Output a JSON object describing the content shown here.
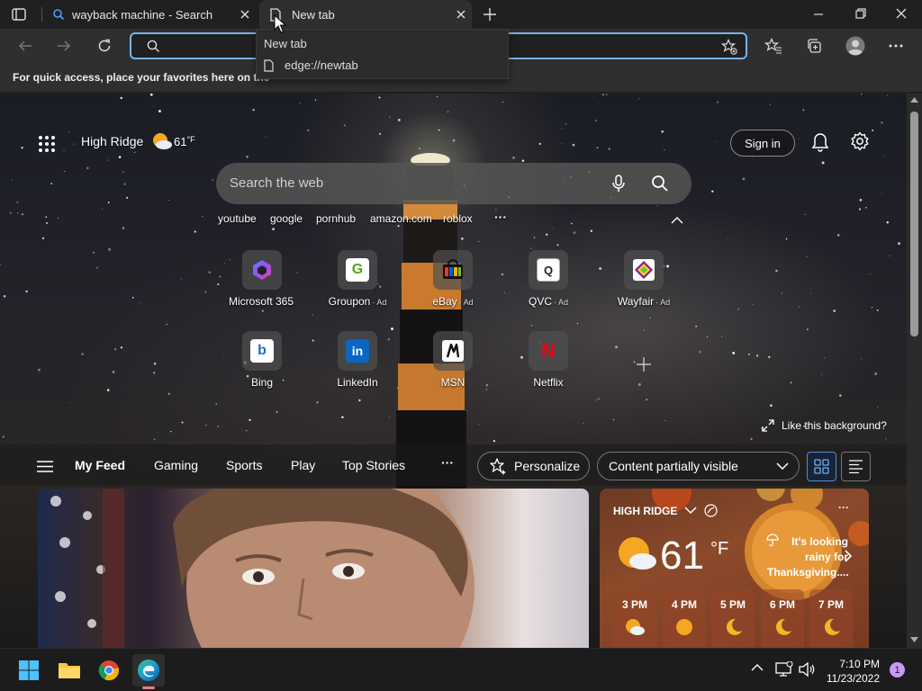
{
  "tabs": [
    {
      "title": "wayback machine - Search",
      "icon": "search-icon"
    },
    {
      "title": "New tab",
      "icon": "page-icon"
    }
  ],
  "omnibox": {
    "value": "",
    "placeholder": ""
  },
  "suggestion": {
    "header": "New tab",
    "url": "edge://newtab"
  },
  "favorites_bar": {
    "message": "For quick access, place your favorites here on the"
  },
  "ntp": {
    "location": "High Ridge",
    "temp": "61",
    "temp_unit": "°F",
    "sign_in": "Sign in",
    "search_placeholder": "Search the web",
    "quick_links": [
      "youtube",
      "google",
      "pornhub",
      "amazon.com",
      "roblox"
    ],
    "more": "···",
    "tiles_row1": [
      {
        "name": "Microsoft 365",
        "ad": ""
      },
      {
        "name": "Groupon",
        "ad": "· Ad"
      },
      {
        "name": "eBay",
        "ad": "· Ad"
      },
      {
        "name": "QVC",
        "ad": "· Ad"
      },
      {
        "name": "Wayfair",
        "ad": "· Ad"
      }
    ],
    "tiles_row2": [
      {
        "name": "Bing"
      },
      {
        "name": "LinkedIn"
      },
      {
        "name": "MSN"
      },
      {
        "name": "Netflix"
      }
    ],
    "like_background": "Like this background?"
  },
  "feed": {
    "tabs": [
      "My Feed",
      "Gaming",
      "Sports",
      "Play",
      "Top Stories"
    ],
    "more": "···",
    "personalize": "Personalize",
    "content_visibility": "Content partially visible"
  },
  "weather_card": {
    "location": "HIGH RIDGE",
    "temp": "61",
    "unit": "°F",
    "tip": "It's looking rainy for Thanksgiving....",
    "hours": [
      {
        "time": "3 PM",
        "icon": "partly-cloudy-icon"
      },
      {
        "time": "4 PM",
        "icon": "sun-icon"
      },
      {
        "time": "5 PM",
        "icon": "moon-icon"
      },
      {
        "time": "6 PM",
        "icon": "moon-icon"
      },
      {
        "time": "7 PM",
        "icon": "moon-icon"
      }
    ]
  },
  "taskbar": {
    "time": "7:10 PM",
    "date": "11/23/2022",
    "notification_count": "1"
  },
  "colors": {
    "accent": "#7ab3e5",
    "chrome_bg": "#2f2f2f",
    "titlebar_bg": "#202020",
    "taskbar_bg": "#1c1c1c"
  }
}
